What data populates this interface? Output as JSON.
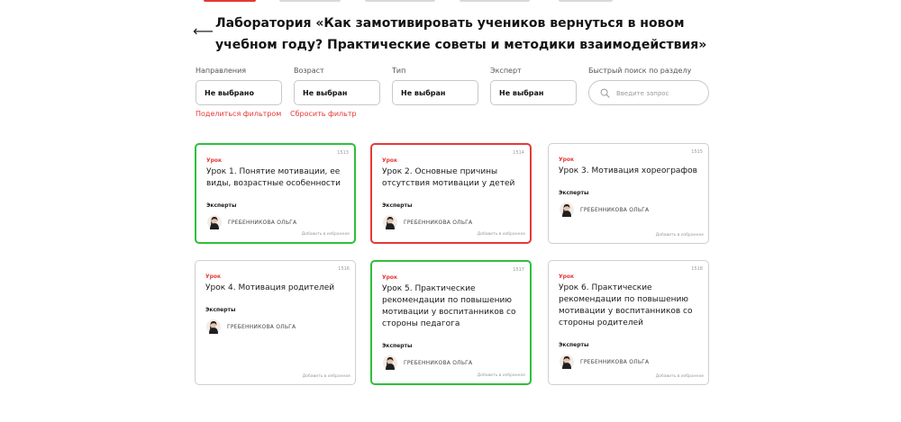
{
  "colors": {
    "accent": "#e53935",
    "highlight_green": "#2fbf3a",
    "border": "#cfcfcf"
  },
  "header": {
    "back_icon": "arrow-left-icon",
    "title": "Лаборатория «Как замотивировать учеников вернуться в новом учебном году? Практические советы и методики взаимодействия»"
  },
  "filters": {
    "direction": {
      "label": "Направления",
      "value": "Не выбрано"
    },
    "age": {
      "label": "Возраст",
      "value": "Не выбран"
    },
    "type": {
      "label": "Тип",
      "value": "Не выбран"
    },
    "expert": {
      "label": "Эксперт",
      "value": "Не выбран"
    },
    "search": {
      "label": "Быстрый поиск по разделу",
      "placeholder": "Введите запрос",
      "icon": "search-icon"
    },
    "share_link": "Поделиться фильтром",
    "reset_link": "Сбросить фильтр"
  },
  "cards": [
    {
      "number": "1513",
      "type": "Урок",
      "title": "Урок 1. Понятие мотивации, ее виды, возрастные особенности",
      "experts_label": "Эксперты",
      "expert_name": "ГРЕБЕННИКОВА ОЛЬГА",
      "fav": "Добавить в избранное",
      "state": "green"
    },
    {
      "number": "1514",
      "type": "Урок",
      "title": "Урок 2. Основные причины отсутствия мотивации у детей",
      "experts_label": "Эксперты",
      "expert_name": "ГРЕБЕННИКОВА ОЛЬГА",
      "fav": "Добавить в избранное",
      "state": "red"
    },
    {
      "number": "1515",
      "type": "Урок",
      "title": "Урок 3. Мотивация хореографов",
      "experts_label": "Эксперты",
      "expert_name": "ГРЕБЕННИКОВА ОЛЬГА",
      "fav": "Добавить в избранное",
      "state": "default"
    },
    {
      "number": "1516",
      "type": "Урок",
      "title": "Урок 4. Мотивация родителей",
      "experts_label": "Эксперты",
      "expert_name": "ГРЕБЕННИКОВА ОЛЬГА",
      "fav": "Добавить в избранное",
      "state": "default"
    },
    {
      "number": "1517",
      "type": "Урок",
      "title": "Урок 5. Практические рекомендации по повышению мотивации у воспитанников со стороны педагога",
      "experts_label": "Эксперты",
      "expert_name": "ГРЕБЕННИКОВА ОЛЬГА",
      "fav": "Добавить в избранное",
      "state": "green"
    },
    {
      "number": "1518",
      "type": "Урок",
      "title": "Урок 6. Практические рекомендации по повышению мотивации у воспитанников со стороны родителей",
      "experts_label": "Эксперты",
      "expert_name": "ГРЕБЕННИКОВА ОЛЬГА",
      "fav": "Добавить в избранное",
      "state": "default"
    }
  ]
}
